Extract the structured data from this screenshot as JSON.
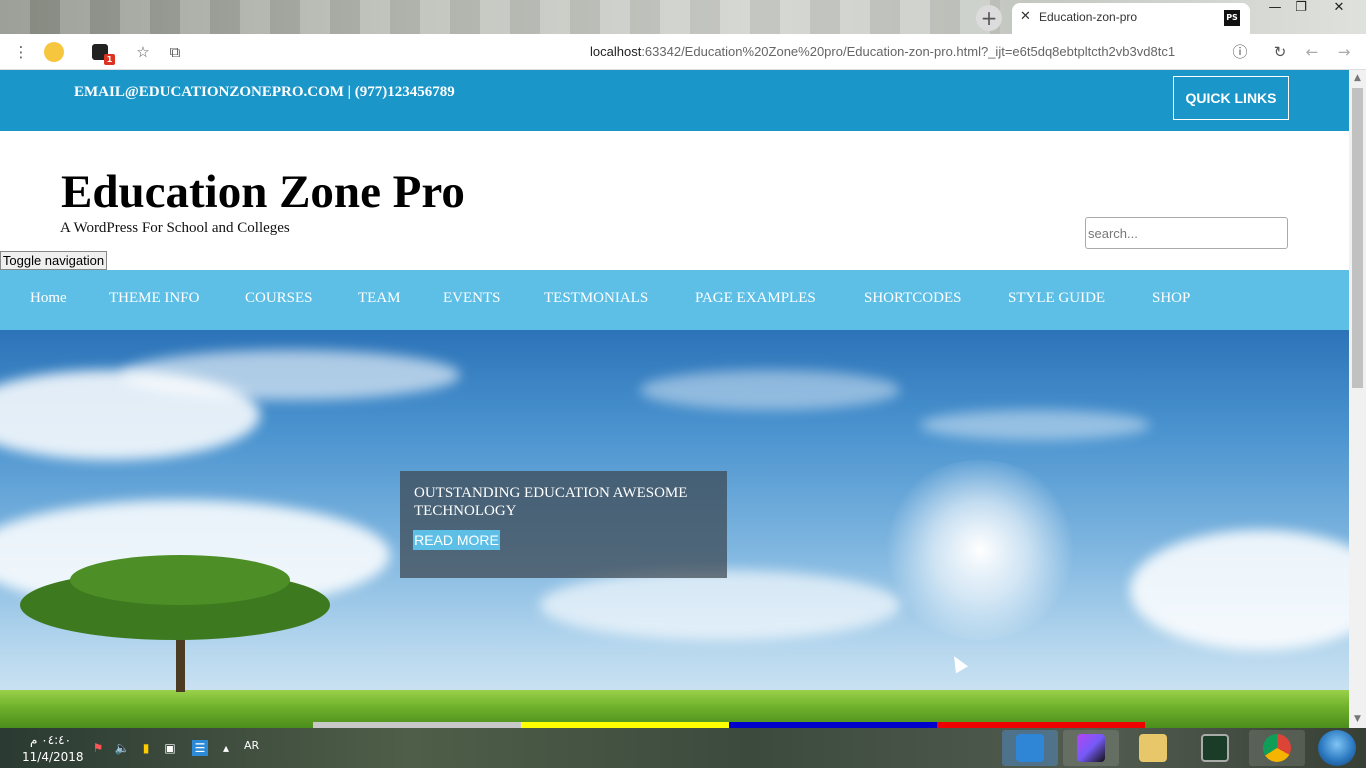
{
  "browser": {
    "tab": {
      "title": "Education-zon-pro",
      "favicon_text": "PS"
    },
    "new_tab_icon": "plus-icon",
    "window_controls": {
      "minimize": "—",
      "restore": "❐",
      "close": "✕"
    },
    "url_host": "localhost",
    "url_rest": ":63342/Education%20Zone%20pro/Education-zon-pro.html?_ijt=e6t5dq8ebtpltcth2vb3vd8tc1",
    "extension_badge": "1"
  },
  "header": {
    "contact": "EMAIL@EDUCATIONZONEPRO.COM | (977)123456789",
    "quick_links": "QUICK LINKS"
  },
  "site": {
    "title": "Education Zone Pro",
    "tagline": "A WordPress For School and Colleges",
    "search_placeholder": "search...",
    "toggle_nav": "Toggle navigation"
  },
  "nav": {
    "items": [
      {
        "label": "Home"
      },
      {
        "label": "THEME INFO"
      },
      {
        "label": "COURSES"
      },
      {
        "label": "TEAM"
      },
      {
        "label": "EVENTS"
      },
      {
        "label": "TESTMONIALS"
      },
      {
        "label": "PAGE EXAMPLES"
      },
      {
        "label": "SHORTCODES"
      },
      {
        "label": "STYLE GUIDE"
      },
      {
        "label": "SHOP"
      }
    ]
  },
  "hero": {
    "caption_title": "OUTSTANDING EDUCATION AWESOME TECHNOLOGY",
    "read_more": "READ MORE"
  },
  "colors": {
    "topbar": "#1b96c9",
    "navbar": "#5dbfe6",
    "slider_bars": [
      "#c8c8c8",
      "#ffff00",
      "#0000cc",
      "#ee0000"
    ]
  },
  "taskbar": {
    "time": "٠٤:٤٠ م",
    "date": "11/4/2018",
    "language": "AR"
  }
}
